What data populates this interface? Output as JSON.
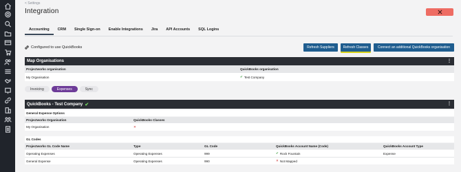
{
  "breadcrumb": "< Settings",
  "page_title": "Integration",
  "tabs": [
    "Accounting",
    "CRM",
    "Single Sign-on",
    "Enable Integrations",
    "Jira",
    "API Accounts",
    "SQL Logins"
  ],
  "active_tab": "Accounting",
  "configured_text": "Configured to use QuickBooks",
  "buttons": {
    "refresh_suppliers": "Refresh Suppliers",
    "refresh_classes": "Refresh Classes",
    "connect": "Connect an additional QuickBooks organisation"
  },
  "map_orgs": {
    "title": "Map Organisations",
    "headers": [
      "Projectworks organisation",
      "QuickBooks organisation"
    ],
    "row": [
      "My Organisation",
      "Test Company"
    ]
  },
  "subtabs": [
    "Invoicing",
    "Expenses",
    "Sync"
  ],
  "active_subtab": "Expenses",
  "company_panel": {
    "title": "QuickBooks - Test Company"
  },
  "expense_options": {
    "title": "General Expense Options",
    "headers": [
      "Projectworks Organisation",
      "QuickBooks Classes"
    ],
    "row": {
      "org": "My Organisation",
      "status": "✕"
    }
  },
  "gl_codes": {
    "title": "GL Codes",
    "headers": [
      "Projectworks GL Code Name",
      "Type",
      "GL Code",
      "QuickBooks Account Name (Code)",
      "QuickBooks Account Type"
    ],
    "rows": [
      {
        "name": "Operating Expenses",
        "type": "Operating Expenses",
        "code": "999",
        "account": "Rock Fountain",
        "account_type": "Expense",
        "mapped": true
      },
      {
        "name": "General Expense",
        "type": "Operating Expenses",
        "code": "990",
        "account": "Not Mapped",
        "account_type": "",
        "mapped": false
      }
    ]
  },
  "menu_glyph": "⋮",
  "colors": {
    "primary_button": "#1f5d8f",
    "close_button": "#ee6c63",
    "active_pill": "#6d3b98",
    "dark_header": "#2a2d33",
    "highlight": "#d8d21a"
  }
}
